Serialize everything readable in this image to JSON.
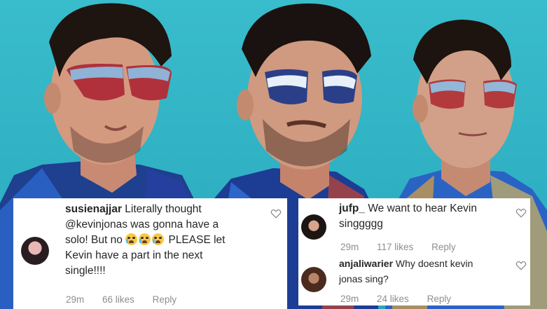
{
  "photo": {
    "description_icon": "photo-background",
    "background_color": "#35b7c7"
  },
  "left_comment": {
    "username": "susienajjar",
    "text_line1": " Literally thought",
    "text_line2": "@kevinjonas was gonna have a",
    "text_line3_a": "solo! But no ",
    "text_line3_emojis": [
      "crying-face",
      "crying-face",
      "crying-face"
    ],
    "text_line3_b": " PLEASE let",
    "text_line4": "Kevin have a part in the next",
    "text_line5": "single!!!!",
    "time": "29m",
    "likes": "66 likes",
    "reply": "Reply",
    "icon": "heart-icon"
  },
  "right_comments": [
    {
      "username": "jufp_",
      "text": "  We want to hear Kevin",
      "text_line2": "singgggg",
      "time": "29m",
      "likes": "117 likes",
      "reply": "Reply",
      "icon": "heart-icon"
    },
    {
      "username": "anjaliwarier",
      "text": " Why doesnt kevin",
      "text_line2": "jonas sing?",
      "time": "29m",
      "likes": "24 likes",
      "reply": "Reply",
      "icon": "heart-icon"
    }
  ]
}
